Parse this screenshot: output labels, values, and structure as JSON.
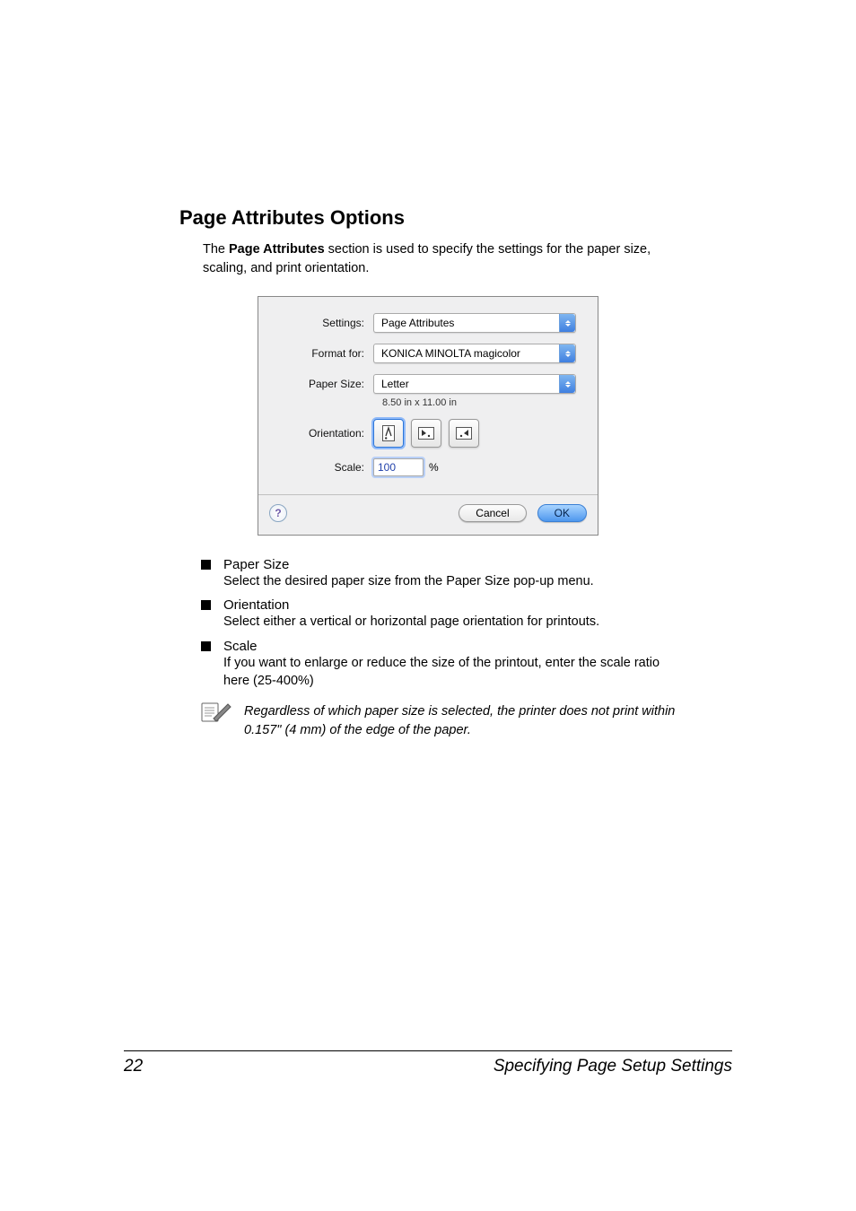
{
  "section": {
    "title": "Page Attributes Options",
    "intro_prefix": "The ",
    "intro_bold": "Page Attributes",
    "intro_suffix": " section is used to specify the settings for the paper size, scaling, and print orientation."
  },
  "dialog": {
    "settings_label": "Settings:",
    "settings_value": "Page Attributes",
    "format_for_label": "Format for:",
    "format_for_value": "KONICA MINOLTA magicolor",
    "paper_size_label": "Paper Size:",
    "paper_size_value": "Letter",
    "paper_size_sub": "8.50 in x 11.00 in",
    "orientation_label": "Orientation:",
    "scale_label": "Scale:",
    "scale_value": "100",
    "scale_suffix": "%",
    "help_symbol": "?",
    "cancel": "Cancel",
    "ok": "OK"
  },
  "bullets": [
    {
      "title": "Paper Size",
      "desc": "Select the desired paper size from the Paper Size pop-up menu."
    },
    {
      "title": "Orientation",
      "desc": "Select either a vertical or horizontal page orientation for printouts."
    },
    {
      "title": "Scale",
      "desc": "If you want to enlarge or reduce the size of the printout, enter the scale ratio here (25-400%)"
    }
  ],
  "note": "Regardless of which paper size is selected, the printer does not print within 0.157\" (4 mm) of the edge of the paper.",
  "footer": {
    "page": "22",
    "title": "Specifying Page Setup Settings"
  }
}
